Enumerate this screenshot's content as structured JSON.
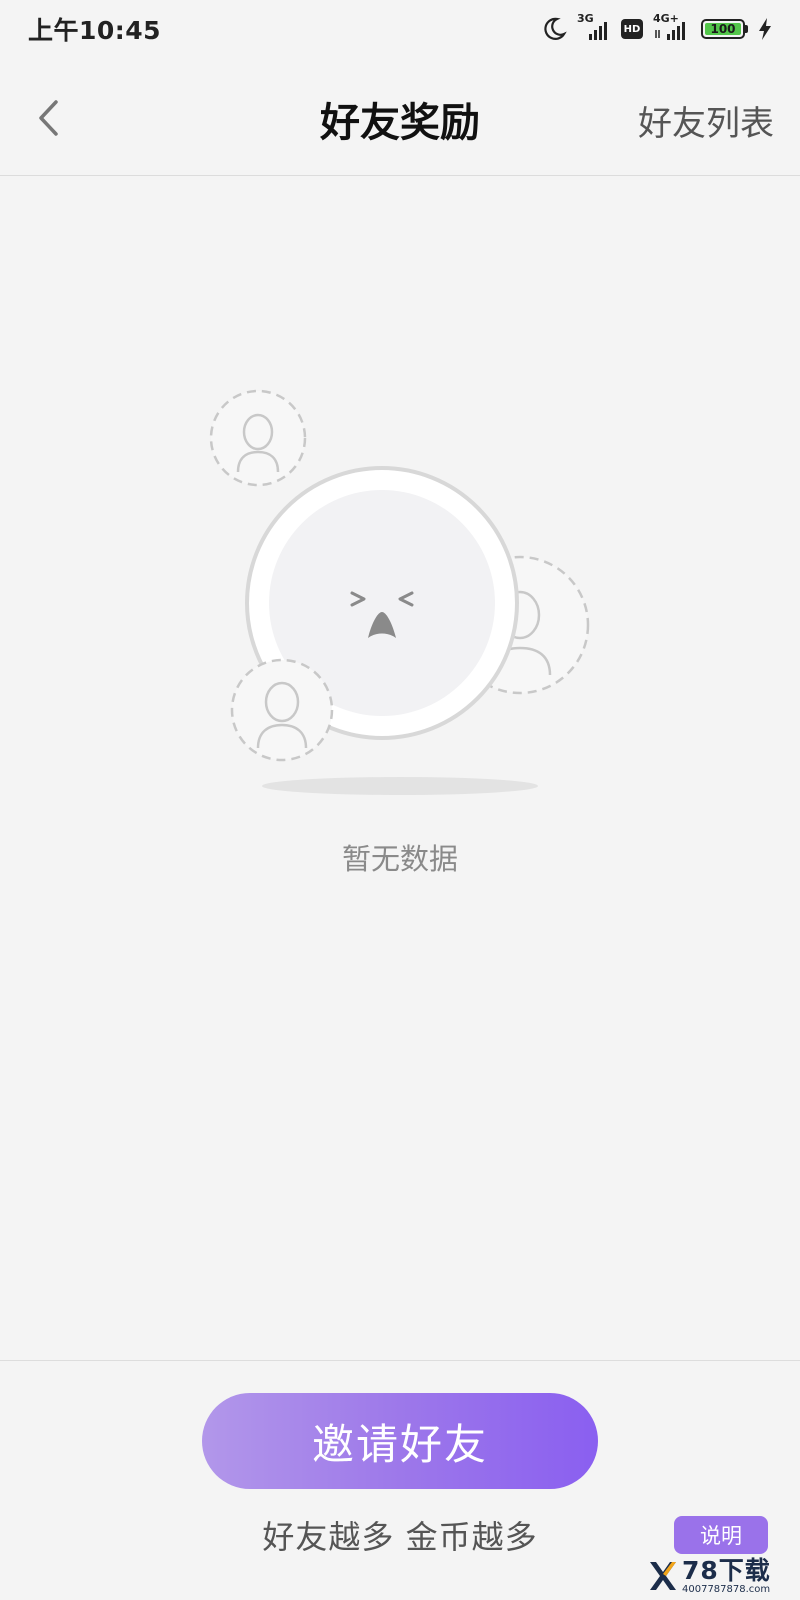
{
  "status_bar": {
    "time": "上午10:45",
    "network_3g": "3G",
    "network_hd": "HD",
    "network_4g": "4G+",
    "battery_level": "100"
  },
  "nav": {
    "title": "好友奖励",
    "right_link": "好友列表"
  },
  "empty_state": {
    "text": "暂无数据"
  },
  "bottom": {
    "invite_label": "邀请好友",
    "slogan": "好友越多 金币越多",
    "explain_label": "说明"
  },
  "watermark": {
    "main": "78下载",
    "sub": "4007787878.com"
  },
  "colors": {
    "accent_start": "#b297ea",
    "accent_end": "#8a5ff0",
    "background": "#f4f4f4"
  }
}
